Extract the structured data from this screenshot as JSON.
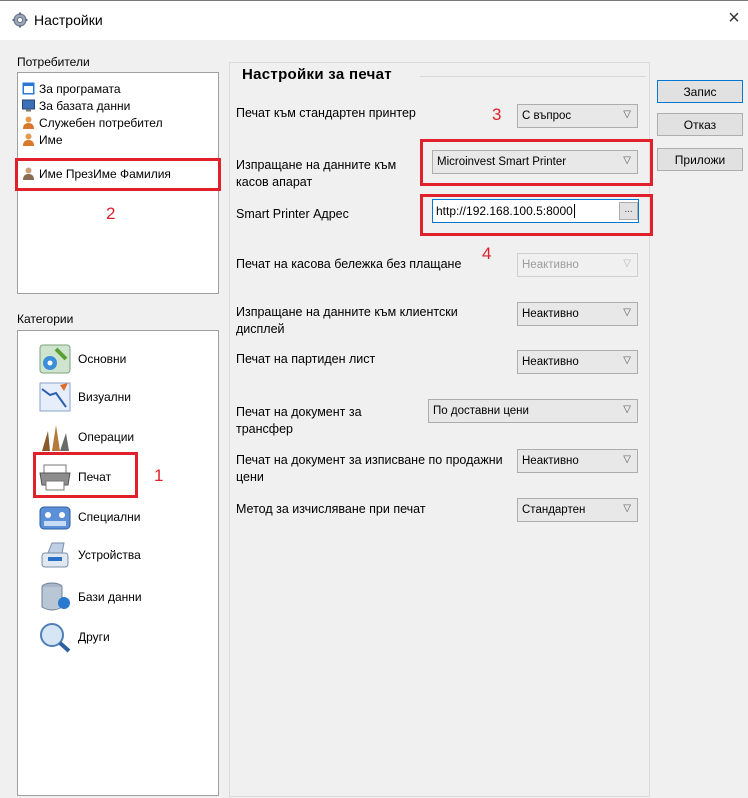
{
  "window": {
    "title": "Настройки",
    "close_glyph": "×",
    "icon": "gear-icon"
  },
  "users": {
    "label": "Потребители",
    "items": [
      {
        "label": "За програмата",
        "icon": "windows-app-icon"
      },
      {
        "label": "За базата данни",
        "icon": "monitor-icon"
      },
      {
        "label": "Служебен потребител",
        "icon": "user-icon"
      },
      {
        "label": "Име",
        "icon": "user-icon"
      },
      {
        "label": "Име ПрезИме Фамилия",
        "icon": "user-icon"
      }
    ]
  },
  "categories": {
    "label": "Категории",
    "items": [
      {
        "label": "Основни",
        "icon": "basic-settings-icon"
      },
      {
        "label": "Визуални",
        "icon": "visual-icon"
      },
      {
        "label": "Операции",
        "icon": "operations-icon"
      },
      {
        "label": "Печат",
        "icon": "printer-icon"
      },
      {
        "label": "Специални",
        "icon": "special-icon"
      },
      {
        "label": "Устройства",
        "icon": "devices-icon"
      },
      {
        "label": "Бази данни",
        "icon": "database-icon"
      },
      {
        "label": "Други",
        "icon": "other-icon"
      }
    ]
  },
  "print_settings": {
    "title": "Настройки за печат",
    "rows": [
      {
        "label": "Печат към стандартен принтер",
        "value": "С въпрос"
      },
      {
        "label": "Изпращане на данните към касов апарат",
        "value": "Microinvest Smart Printer"
      },
      {
        "label": "Smart Printer Адрес",
        "value": "http://192.168.100.5:8000",
        "browse": "..."
      },
      {
        "label": "Печат на касова бележка без плащане",
        "value": "Неактивно"
      },
      {
        "label": "Изпращане на данните към клиентски дисплей",
        "value": "Неактивно"
      },
      {
        "label": "Печат на партиден лист",
        "value": "Неактивно"
      },
      {
        "label": "Печат на документ за трансфер",
        "value": "По доставни цени"
      },
      {
        "label": "Печат на документ за изписване по продажни цени",
        "value": "Неактивно"
      },
      {
        "label": "Метод за изчисляване при печат",
        "value": "Стандартен"
      }
    ]
  },
  "buttons": {
    "save": "Запис",
    "cancel": "Отказ",
    "apply": "Приложи"
  },
  "annotations": [
    "1",
    "2",
    "3",
    "4"
  ],
  "colors": {
    "highlight": "#e0202a",
    "focus": "#0078d7"
  }
}
